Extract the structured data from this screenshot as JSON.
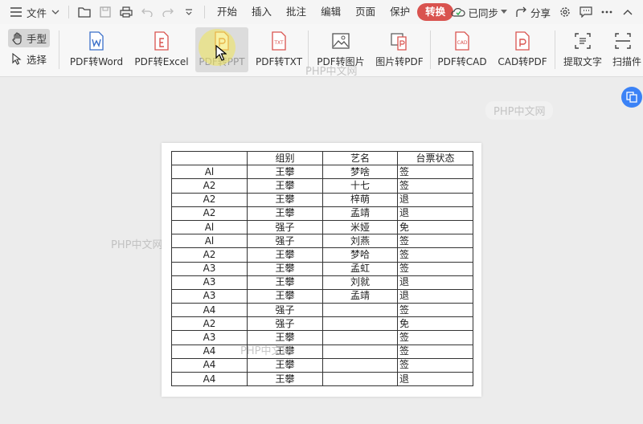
{
  "menu": {
    "file_label": "文件",
    "tabs": [
      "开始",
      "插入",
      "批注",
      "编辑",
      "页面",
      "保护",
      "转换"
    ],
    "active_tab": "转换",
    "sync_label": "已同步",
    "share_label": "分享"
  },
  "ribbon": {
    "hand_label": "手型",
    "select_label": "选择",
    "buttons": [
      "PDF转Word",
      "PDF转Excel",
      "PDF转PPT",
      "PDF转TXT",
      "PDF转图片",
      "图片转PDF",
      "PDF转CAD",
      "CAD转PDF",
      "提取文字",
      "扫描件"
    ]
  },
  "watermarks": [
    "PHP中文网",
    "PHP中文网",
    "PHP中文网",
    "PHP中文网",
    "php.cn"
  ],
  "table": {
    "headers": [
      "",
      "组别",
      "艺名",
      "台票状态"
    ],
    "rows": [
      [
        "Al",
        "王攀",
        "梦啥",
        "签"
      ],
      [
        "A2",
        "王攀",
        "十七",
        "签"
      ],
      [
        "A2",
        "王攀",
        "梓萌",
        "退"
      ],
      [
        "A2",
        "王攀",
        "孟靖",
        "退"
      ],
      [
        "Al",
        "强子",
        "米娅",
        "免"
      ],
      [
        "Al",
        "强子",
        "刘燕",
        "签"
      ],
      [
        "A2",
        "王攀",
        "梦哈",
        "签"
      ],
      [
        "A3",
        "王攀",
        "孟虹",
        "签"
      ],
      [
        "A3",
        "王攀",
        "刘就",
        "退"
      ],
      [
        "A3",
        "王攀",
        "孟靖",
        "退"
      ],
      [
        "A4",
        "强子",
        "",
        "签"
      ],
      [
        "A2",
        "强子",
        "",
        "免"
      ],
      [
        "A3",
        "王攀",
        "",
        "签"
      ],
      [
        "A4",
        "王攀",
        "",
        "签"
      ],
      [
        "A4",
        "王攀",
        "",
        "签"
      ],
      [
        "A4",
        "王攀",
        "",
        "退"
      ]
    ]
  }
}
